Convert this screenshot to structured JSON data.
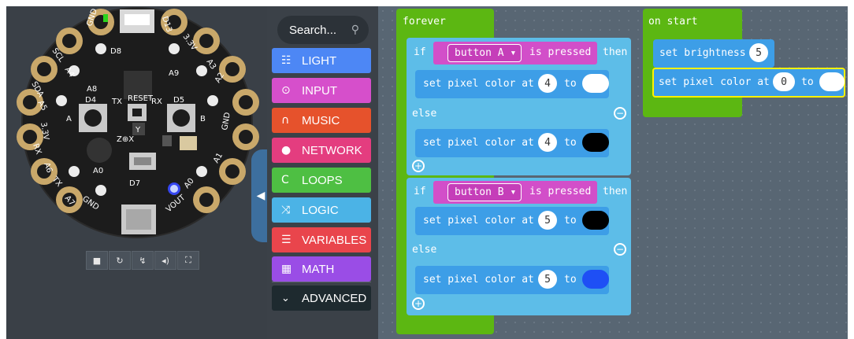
{
  "simulator": {
    "board_labels": {
      "gnd_top": "GND",
      "d13": "D13",
      "scl": "SCL",
      "a4": "A4",
      "v33_top": "3.3V",
      "d8": "D8",
      "a3": "A3",
      "sda": "SDA",
      "a5": "A5",
      "a8": "A8",
      "a9": "A9",
      "a2": "A2",
      "d4": "D4",
      "tx": "TX",
      "reset": "RESET",
      "rx": "RX",
      "d5": "D5",
      "v33_left": "3.3V",
      "gnd_right": "GND",
      "y_axis": "Y",
      "z_x_axis": "Z⊕X",
      "rx_left": "RX",
      "a6": "A6",
      "a1": "A1",
      "a0_mid": "A0",
      "d7": "D7",
      "tx_left": "TX",
      "a7": "A7",
      "a0_right": "A0",
      "gnd_bottom": "GND",
      "vout": "VOUT",
      "btn_a": "A",
      "btn_b": "B"
    },
    "controls": [
      "■",
      "↻",
      "↯",
      "◂)",
      "⛶"
    ]
  },
  "toolbox": {
    "search_label": "Search...",
    "categories": [
      {
        "label": "LIGHT",
        "icon": "☷",
        "color": "#4d87f5"
      },
      {
        "label": "INPUT",
        "icon": "⊙",
        "color": "#d64fcb"
      },
      {
        "label": "MUSIC",
        "icon": "∩",
        "color": "#e6522c"
      },
      {
        "label": "NETWORK",
        "icon": "●",
        "color": "#e43d7f"
      },
      {
        "label": "LOOPS",
        "icon": "C",
        "color": "#4ebf43"
      },
      {
        "label": "LOGIC",
        "icon": "⤨",
        "color": "#4bb3e6"
      },
      {
        "label": "VARIABLES",
        "icon": "☰",
        "color": "#e9454c"
      },
      {
        "label": "MATH",
        "icon": "▦",
        "color": "#9a4de6"
      }
    ],
    "advanced": {
      "label": "ADVANCED",
      "icon": "⌄"
    }
  },
  "workspace": {
    "forever": {
      "label": "forever",
      "if1": {
        "kw_if": "if",
        "button": "button A ▾",
        "event": "is pressed",
        "kw_then": "then",
        "then_block": {
          "label": "set pixel color at",
          "index": "4",
          "kw_to": "to",
          "color": "#ffffff"
        },
        "kw_else": "else",
        "else_block": {
          "label": "set pixel color at",
          "index": "4",
          "kw_to": "to",
          "color": "#000000"
        }
      },
      "if2": {
        "kw_if": "if",
        "button": "button B ▾",
        "event": "is pressed",
        "kw_then": "then",
        "then_block": {
          "label": "set pixel color at",
          "index": "5",
          "kw_to": "to",
          "color": "#000000"
        },
        "kw_else": "else",
        "else_block": {
          "label": "set pixel color at",
          "index": "5",
          "kw_to": "to",
          "color": "#1e4ff5"
        }
      }
    },
    "on_start": {
      "label": "on start",
      "brightness": {
        "label": "set brightness",
        "value": "5"
      },
      "pixel": {
        "label": "set pixel color at",
        "index": "0",
        "kw_to": "to",
        "color": "#ffffff"
      }
    }
  }
}
